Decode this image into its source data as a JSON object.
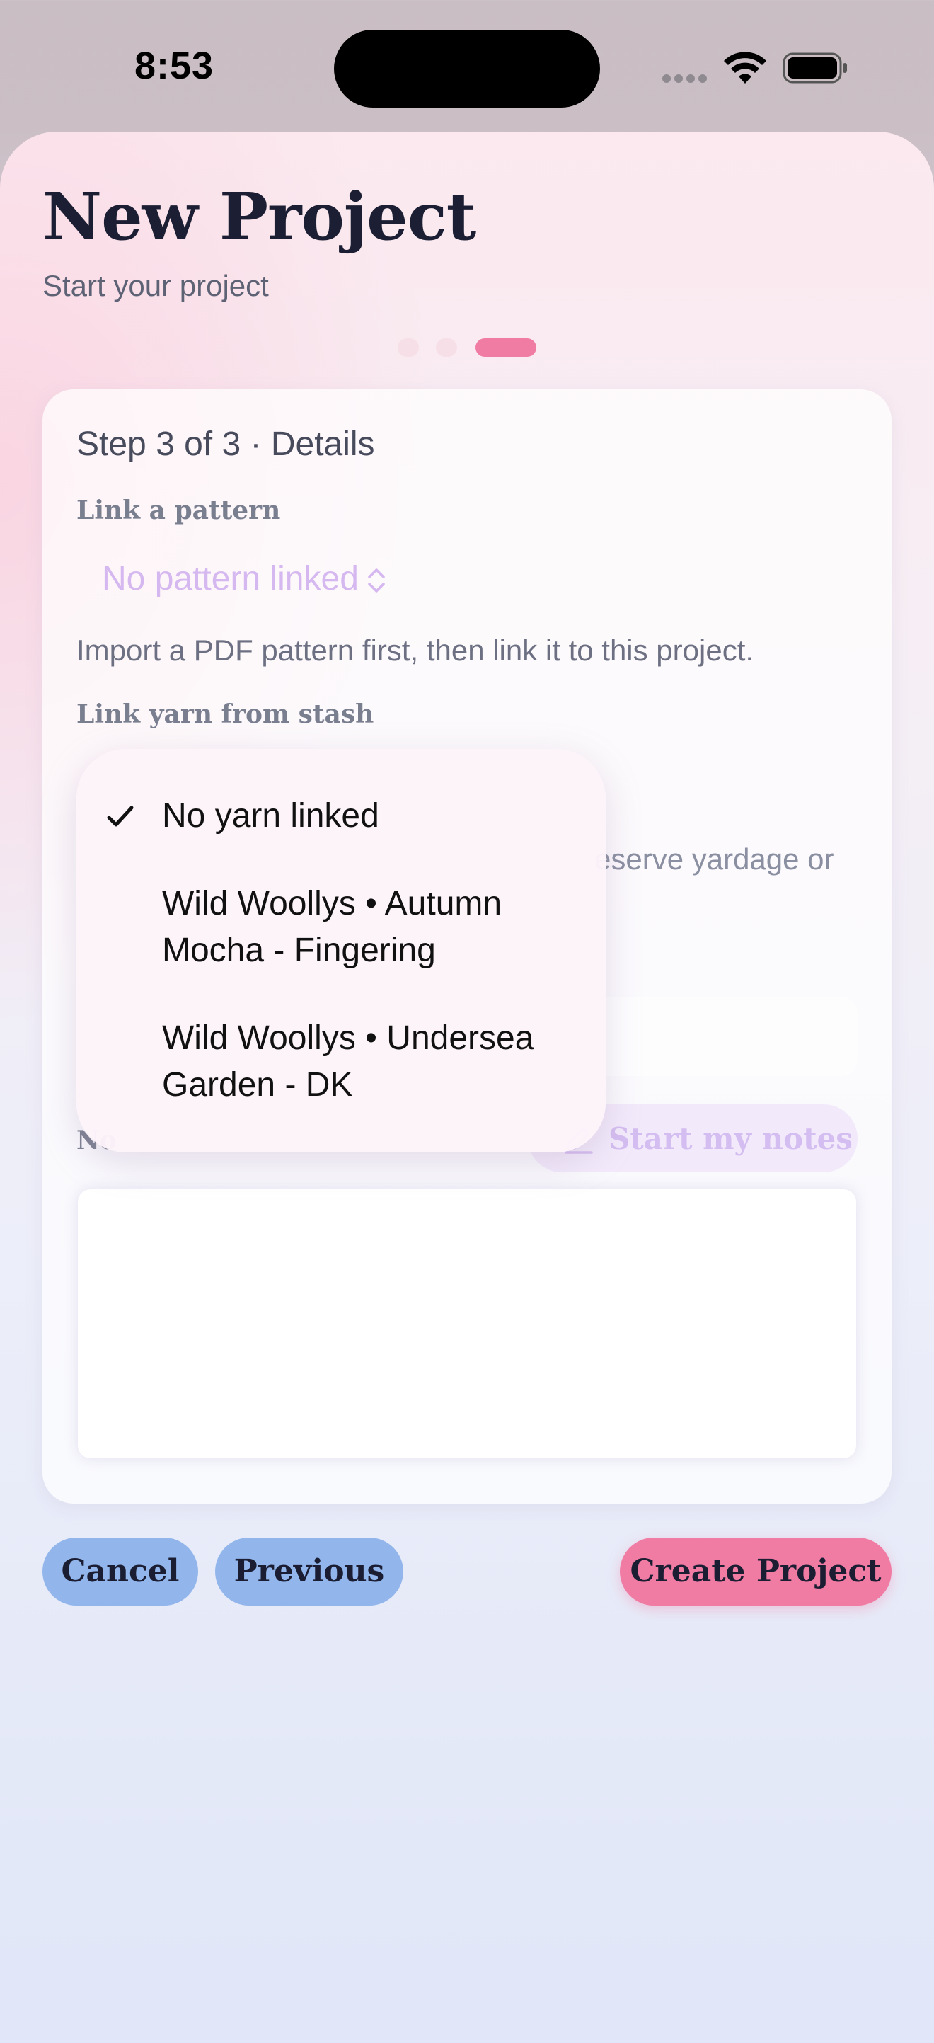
{
  "status_bar": {
    "time": "8:53"
  },
  "header": {
    "title": "New Project",
    "subtitle": "Start your project"
  },
  "stepper": {
    "current": 3,
    "total": 3
  },
  "step": {
    "label": "Step 3 of 3 · Details"
  },
  "pattern": {
    "section_label": "Link a pattern",
    "selected": "No pattern linked",
    "help": "Import a PDF pattern first, then link it to this project."
  },
  "yarn": {
    "section_label": "Link yarn from stash",
    "help_fragment": "eserve yardage or",
    "menu": {
      "options": [
        {
          "label": "No yarn linked",
          "selected": true
        },
        {
          "label": "Wild Woollys • Autumn Mocha - Fingering",
          "selected": false
        },
        {
          "label": "Wild Woollys • Undersea Garden - DK",
          "selected": false
        }
      ]
    }
  },
  "notes": {
    "label_fragment": "No",
    "start_button": "Start my notes",
    "value": ""
  },
  "footer": {
    "cancel": "Cancel",
    "previous": "Previous",
    "create": "Create Project"
  },
  "colors": {
    "accent_pink": "#f07ca4",
    "accent_blue": "#92b6ec",
    "placeholder_purple": "#d6b8f0"
  }
}
